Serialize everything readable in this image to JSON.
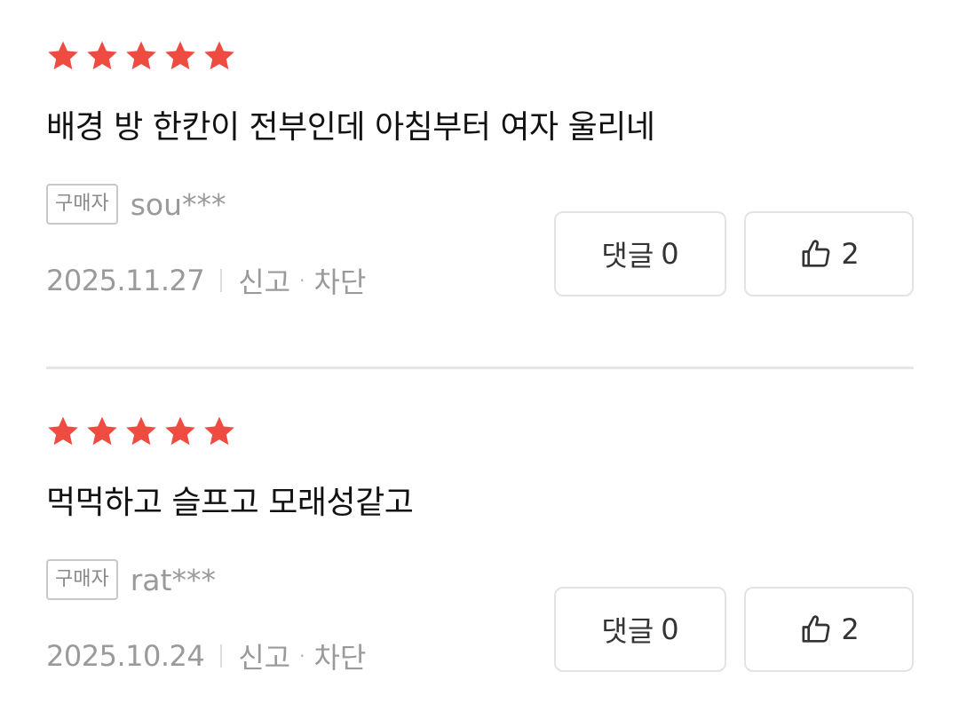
{
  "reviews": [
    {
      "rating": 5,
      "text": "배경 방 한칸이 전부인데 아침부터 여자 울리네",
      "badge": "구매자",
      "user": "sou***",
      "date": "2025.11.27",
      "report_label": "신고",
      "dot": "·",
      "block_label": "차단",
      "comment_label": "댓글",
      "comment_count": "0",
      "like_count": "2"
    },
    {
      "rating": 5,
      "text": "먹먹하고 슬프고 모래성같고",
      "badge": "구매자",
      "user": "rat***",
      "date": "2025.10.24",
      "report_label": "신고",
      "dot": "·",
      "block_label": "차단",
      "comment_label": "댓글",
      "comment_count": "0",
      "like_count": "2"
    }
  ],
  "colors": {
    "star": "#ee4c40",
    "muted_text": "#9a9a9a",
    "border": "#e3e3e3"
  },
  "icons": {
    "star": "star-icon",
    "like": "thumbs-up-icon"
  }
}
